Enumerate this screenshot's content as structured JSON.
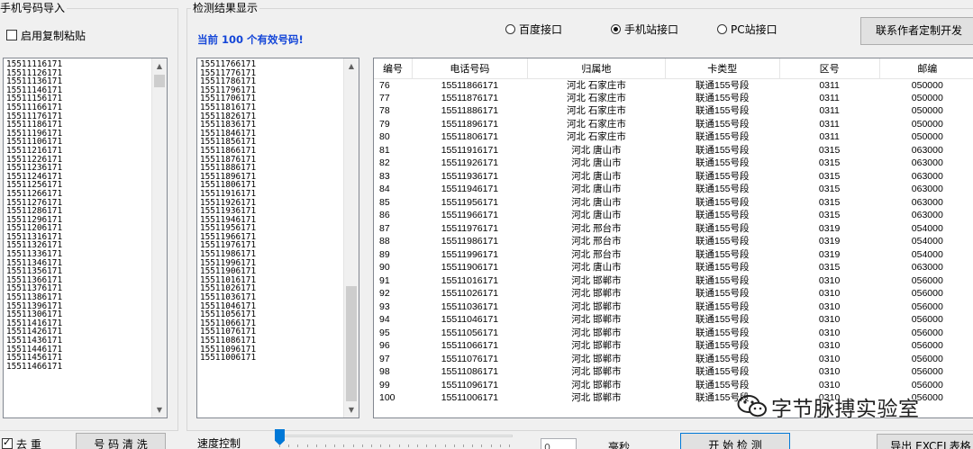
{
  "import_group": {
    "title": "手机号码导入",
    "enable_paste_label": "启用复制粘贴",
    "enable_paste_checked": false,
    "numbers": [
      "15511116171",
      "15511126171",
      "15511136171",
      "15511146171",
      "15511156171",
      "15511166171",
      "15511176171",
      "15511186171",
      "15511196171",
      "15511106171",
      "15511216171",
      "15511226171",
      "15511236171",
      "15511246171",
      "15511256171",
      "15511266171",
      "15511276171",
      "15511286171",
      "15511296171",
      "15511206171",
      "15511316171",
      "15511326171",
      "15511336171",
      "15511346171",
      "15511356171",
      "15511366171",
      "15511376171",
      "15511386171",
      "15511396171",
      "15511306171",
      "15511416171",
      "15511426171",
      "15511436171",
      "15511446171",
      "15511456171",
      "15511466171"
    ],
    "dedup_label": "去 重",
    "dedup_checked": true,
    "clean_button": "号 码 清 洗"
  },
  "result_group": {
    "title": "检测结果显示",
    "count_text": "当前 100 个有效号码!",
    "radios": [
      {
        "label": "百度接口",
        "checked": false
      },
      {
        "label": "手机站接口",
        "checked": true
      },
      {
        "label": "PC站接口",
        "checked": false
      }
    ],
    "contact_button": "联系作者定制开发",
    "valid_numbers": [
      "15511766171",
      "15511776171",
      "15511786171",
      "15511796171",
      "15511706171",
      "15511816171",
      "15511826171",
      "15511836171",
      "15511846171",
      "15511856171",
      "15511866171",
      "15511876171",
      "15511886171",
      "15511896171",
      "15511806171",
      "15511916171",
      "15511926171",
      "15511936171",
      "15511946171",
      "15511956171",
      "15511966171",
      "15511976171",
      "15511986171",
      "15511996171",
      "15511906171",
      "15511016171",
      "15511026171",
      "15511036171",
      "15511046171",
      "15511056171",
      "15511066171",
      "15511076171",
      "15511086171",
      "15511096171",
      "15511006171"
    ],
    "table": {
      "headers": [
        "编号",
        "电话号码",
        "归属地",
        "卡类型",
        "区号",
        "邮编"
      ],
      "rows": [
        [
          "76",
          "15511866171",
          "河北 石家庄市",
          "联通155号段",
          "0311",
          "050000"
        ],
        [
          "77",
          "15511876171",
          "河北 石家庄市",
          "联通155号段",
          "0311",
          "050000"
        ],
        [
          "78",
          "15511886171",
          "河北 石家庄市",
          "联通155号段",
          "0311",
          "050000"
        ],
        [
          "79",
          "15511896171",
          "河北 石家庄市",
          "联通155号段",
          "0311",
          "050000"
        ],
        [
          "80",
          "15511806171",
          "河北 石家庄市",
          "联通155号段",
          "0311",
          "050000"
        ],
        [
          "81",
          "15511916171",
          "河北 唐山市",
          "联通155号段",
          "0315",
          "063000"
        ],
        [
          "82",
          "15511926171",
          "河北 唐山市",
          "联通155号段",
          "0315",
          "063000"
        ],
        [
          "83",
          "15511936171",
          "河北 唐山市",
          "联通155号段",
          "0315",
          "063000"
        ],
        [
          "84",
          "15511946171",
          "河北 唐山市",
          "联通155号段",
          "0315",
          "063000"
        ],
        [
          "85",
          "15511956171",
          "河北 唐山市",
          "联通155号段",
          "0315",
          "063000"
        ],
        [
          "86",
          "15511966171",
          "河北 唐山市",
          "联通155号段",
          "0315",
          "063000"
        ],
        [
          "87",
          "15511976171",
          "河北 邢台市",
          "联通155号段",
          "0319",
          "054000"
        ],
        [
          "88",
          "15511986171",
          "河北 邢台市",
          "联通155号段",
          "0319",
          "054000"
        ],
        [
          "89",
          "15511996171",
          "河北 邢台市",
          "联通155号段",
          "0319",
          "054000"
        ],
        [
          "90",
          "15511906171",
          "河北 唐山市",
          "联通155号段",
          "0315",
          "063000"
        ],
        [
          "91",
          "15511016171",
          "河北 邯郸市",
          "联通155号段",
          "0310",
          "056000"
        ],
        [
          "92",
          "15511026171",
          "河北 邯郸市",
          "联通155号段",
          "0310",
          "056000"
        ],
        [
          "93",
          "15511036171",
          "河北 邯郸市",
          "联通155号段",
          "0310",
          "056000"
        ],
        [
          "94",
          "15511046171",
          "河北 邯郸市",
          "联通155号段",
          "0310",
          "056000"
        ],
        [
          "95",
          "15511056171",
          "河北 邯郸市",
          "联通155号段",
          "0310",
          "056000"
        ],
        [
          "96",
          "15511066171",
          "河北 邯郸市",
          "联通155号段",
          "0310",
          "056000"
        ],
        [
          "97",
          "15511076171",
          "河北 邯郸市",
          "联通155号段",
          "0310",
          "056000"
        ],
        [
          "98",
          "15511086171",
          "河北 邯郸市",
          "联通155号段",
          "0310",
          "056000"
        ],
        [
          "99",
          "15511096171",
          "河北 邯郸市",
          "联通155号段",
          "0310",
          "056000"
        ],
        [
          "100",
          "15511006171",
          "河北 邯郸市",
          "联通155号段",
          "0310",
          "056000"
        ]
      ]
    }
  },
  "controls": {
    "speed_label": "速度控制",
    "speed_value": "0",
    "speed_unit": "毫秒",
    "start_button": "开 始 检 测",
    "export_button": "导出 EXCEL表格"
  },
  "watermark": {
    "text": "字节脉搏实验室",
    "icon": "wechat-icon"
  },
  "colors": {
    "accent_blue": "#0078d7",
    "count_text": "#1446d8"
  }
}
